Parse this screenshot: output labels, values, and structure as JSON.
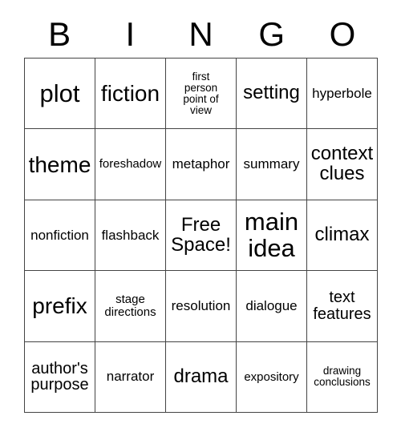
{
  "card": {
    "title_letters": [
      "B",
      "I",
      "N",
      "G",
      "O"
    ],
    "grid": {
      "columns": 5,
      "rows": 5,
      "free_space_label": "Free Space!",
      "free_space_position": {
        "row": 3,
        "column": 3
      },
      "cells": [
        [
          {
            "text": "plot",
            "size": "xl"
          },
          {
            "text": "fiction",
            "size": "lg"
          },
          {
            "text": "first\nperson\npoint of\nview",
            "size": "tiny"
          },
          {
            "text": "setting",
            "size": "md"
          },
          {
            "text": "hyperbole",
            "size": "xs"
          }
        ],
        [
          {
            "text": "theme",
            "size": "lg"
          },
          {
            "text": "foreshadow",
            "size": "xxs"
          },
          {
            "text": "metaphor",
            "size": "xs"
          },
          {
            "text": "summary",
            "size": "xs"
          },
          {
            "text": "context\nclues",
            "size": "md"
          }
        ],
        [
          {
            "text": "nonfiction",
            "size": "xs"
          },
          {
            "text": "flashback",
            "size": "xs"
          },
          {
            "text": "Free\nSpace!",
            "size": "md"
          },
          {
            "text": "main\nidea",
            "size": "xl"
          },
          {
            "text": "climax",
            "size": "md"
          }
        ],
        [
          {
            "text": "prefix",
            "size": "lg"
          },
          {
            "text": "stage\ndirections",
            "size": "xxs"
          },
          {
            "text": "resolution",
            "size": "xs"
          },
          {
            "text": "dialogue",
            "size": "xs"
          },
          {
            "text": "text\nfeatures",
            "size": "sm"
          }
        ],
        [
          {
            "text": "author's\npurpose",
            "size": "sm"
          },
          {
            "text": "narrator",
            "size": "xs"
          },
          {
            "text": "drama",
            "size": "md"
          },
          {
            "text": "expository",
            "size": "xxs"
          },
          {
            "text": "drawing\nconclusions",
            "size": "tiny"
          }
        ]
      ]
    },
    "colors": {
      "background": "#ffffff",
      "text": "#000000",
      "grid_line": "#444444"
    }
  }
}
